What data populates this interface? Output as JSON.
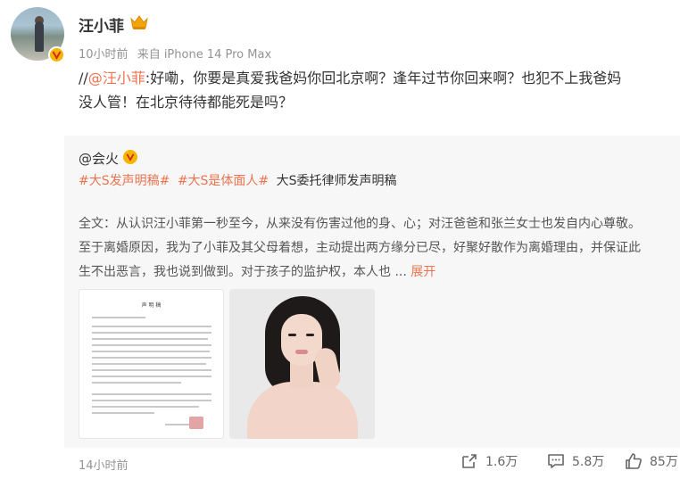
{
  "author": {
    "name": "汪小菲",
    "time": "10小时前",
    "source": "来自 iPhone 14 Pro Max"
  },
  "post": {
    "slash": "//",
    "mention": "@汪小菲",
    "line1": ":好嘞，你要是真爱我爸妈你回北京啊？逢年过节你回来啊？也犯不上我爸妈",
    "line2": "没人管！在北京待待都能死是吗？"
  },
  "repost": {
    "author": "@会火",
    "tags": [
      "#大S发声明稿#",
      "#大S是体面人#"
    ],
    "tag_plain": "大S委托律师发声明稿",
    "line1": "全文：从认识汪小菲第一秒至今，从来没有伤害过他的身、心；对汪爸爸和张兰女士也发自内心尊敬。",
    "line2": "至于离婚原因，我为了小菲及其父母着想，主动提出两方缘分已尽，好聚好散作为离婚理由，并保证此",
    "line3": "生不出恶言，我也说到做到。对于孩子的监护权，本人也 ... ",
    "expand": "展开",
    "doc_title": "声 明 稿"
  },
  "footer": {
    "time": "14小时前",
    "share_count": "1.6万",
    "comment_count": "5.8万",
    "like_count": "85万"
  },
  "colors": {
    "accent": "#eb7350",
    "badge": "#f7b500",
    "repost_bg": "#f7f7f7",
    "meta": "#939393"
  },
  "icons": [
    "verified-badge-icon",
    "crown-icon",
    "share-icon",
    "comment-icon",
    "like-icon"
  ]
}
